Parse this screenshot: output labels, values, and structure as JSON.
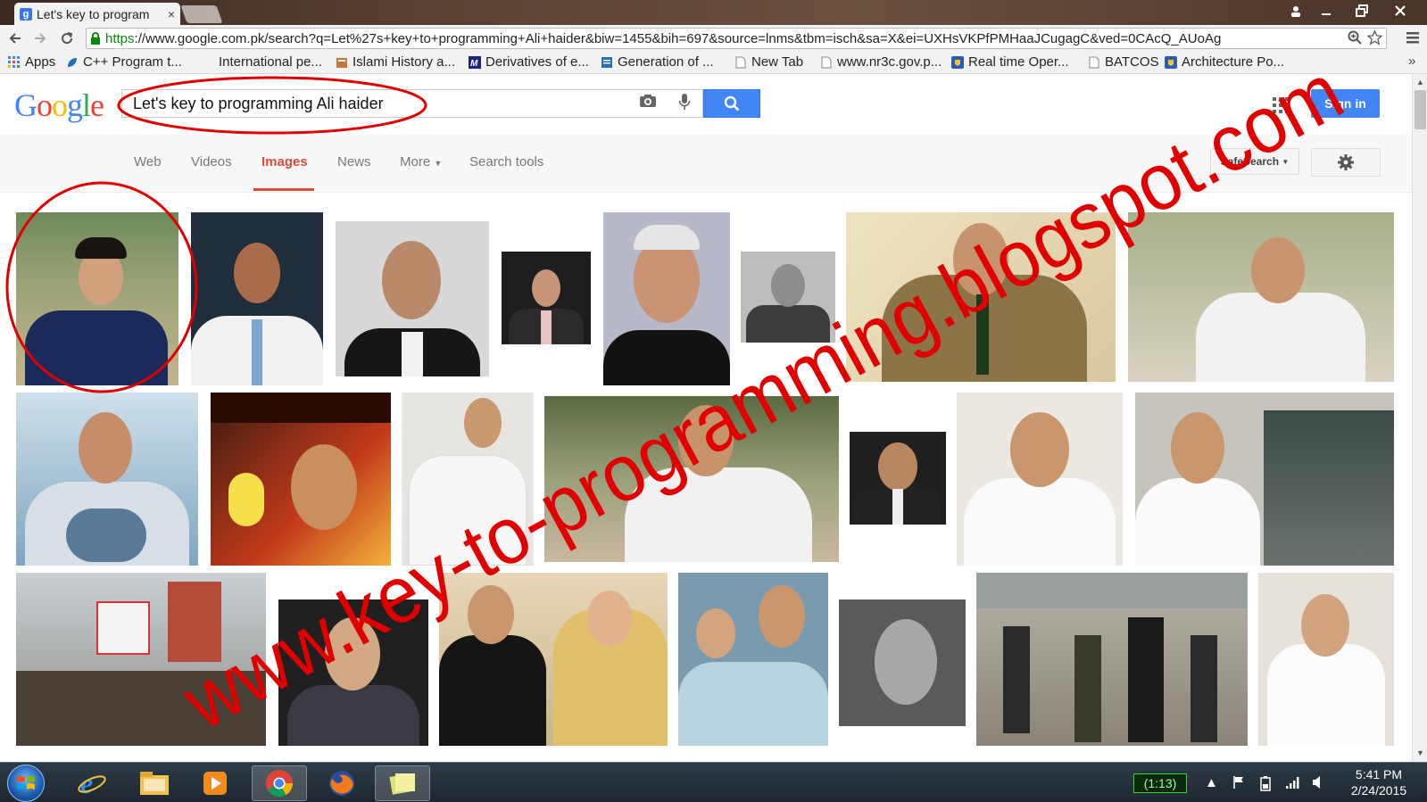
{
  "browser": {
    "tab_title": "Let's key to program",
    "tab_close": "×",
    "url_scheme": "https",
    "url_rest": "://www.google.com.pk/search?q=Let%27s+key+to+programming+Ali+haider&biw=1455&bih=697&source=lnms&tbm=isch&sa=X&ei=UXHsVKPfPMHaaJCugagC&ved=0CAcQ_AUoAg"
  },
  "bookmarks": [
    {
      "label": "Apps",
      "icon": "apps-icon"
    },
    {
      "label": "C++ Program t...",
      "icon": "leaf-icon"
    },
    {
      "label": "International pe...",
      "icon": "none"
    },
    {
      "label": "Islami History a...",
      "icon": "book-icon"
    },
    {
      "label": "Derivatives of e...",
      "icon": "m-icon"
    },
    {
      "label": "Generation of ...",
      "icon": "doc-icon"
    },
    {
      "label": "New Tab",
      "icon": "page-icon"
    },
    {
      "label": "www.nr3c.gov.p...",
      "icon": "page-icon"
    },
    {
      "label": "Real time Oper...",
      "icon": "shield-icon"
    },
    {
      "label": "BATCOS",
      "icon": "page-icon"
    },
    {
      "label": "Architecture Po...",
      "icon": "shield-icon"
    }
  ],
  "bookmarks_more": "»",
  "google": {
    "logo": "Google",
    "query": "Let's key to programming Ali haider",
    "sign_in": "Sign in",
    "safesearch": "SafeSearch"
  },
  "nav": {
    "web": "Web",
    "videos": "Videos",
    "images": "Images",
    "news": "News",
    "more": "More",
    "search_tools": "Search tools"
  },
  "overlay": {
    "watermark": "www.key-to-programming.blogspot.com",
    "color": "#e00000"
  },
  "taskbar": {
    "battery": "(1:13)",
    "time": "5:41 PM",
    "date": "2/24/2015"
  },
  "colors": {
    "google_blue": "#4285f4",
    "images_red": "#dd4b39"
  }
}
